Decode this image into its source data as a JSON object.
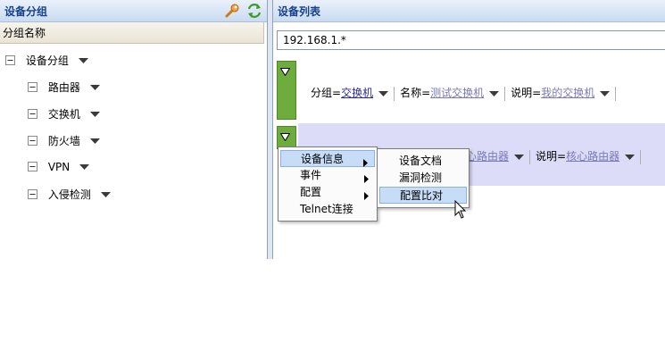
{
  "left_panel": {
    "title": "设备分组",
    "column_header": "分组名称",
    "tree": {
      "root": "设备分组",
      "children": [
        "路由器",
        "交换机",
        "防火墙",
        "VPN",
        "入侵检测"
      ]
    }
  },
  "right_panel": {
    "title": "设备列表",
    "search_value": "192.168.1.*",
    "rows": [
      {
        "group_label": "分组=",
        "group_value": "交换机",
        "name_label": "名称=",
        "name_value": "测试交换机",
        "desc_label": "说明=",
        "desc_value": "我的交换机"
      },
      {
        "name_value_partial": "心路由器",
        "desc_label": "说明=",
        "desc_value": "核心路由器"
      }
    ]
  },
  "context_menu": {
    "items": [
      {
        "label": "设备信息",
        "has_submenu": true
      },
      {
        "label": "事件",
        "has_submenu": true
      },
      {
        "label": "配置",
        "has_submenu": true
      },
      {
        "label": "Telnet连接",
        "has_submenu": false
      }
    ],
    "submenu_items": [
      "设备文档",
      "漏洞检测",
      "配置比对"
    ]
  },
  "icons": {
    "header_tools": [
      "wrench-icon",
      "refresh-icon"
    ]
  },
  "colors": {
    "header_text": "#15428b",
    "row_marker": "#6fac3e",
    "row_highlight": "#dcdcf8",
    "menu_highlight": "#c6dcf7",
    "link": "#2a2aa8"
  }
}
